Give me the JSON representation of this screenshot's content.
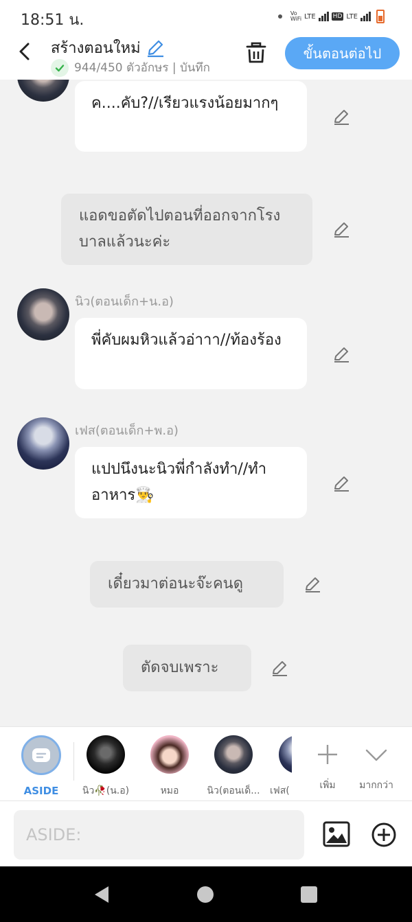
{
  "status_bar": {
    "time": "18:51 น."
  },
  "header": {
    "title": "สร้างตอนใหม่",
    "stats": "944/450 ตัวอักษร | บันทึก",
    "next_label": "ขั้นตอนต่อไป"
  },
  "chat": {
    "messages": [
      {
        "type": "dialogue",
        "text": "ค....คับ?//เรียวแรงน้อยมากๆ"
      },
      {
        "type": "narration",
        "text": "แอดขอตัดไปตอนที่ออกจากโรงบาลแล้วนะค่ะ"
      },
      {
        "type": "dialogue",
        "name": "นิว(ตอนเด็ก+น.อ)",
        "text": "พี่คับผมหิวแล้วอ่าาา//ท้องร้อง"
      },
      {
        "type": "dialogue",
        "name": "เฟส(ตอนเด็ก+พ.อ)",
        "text": "แปปนึงนะนิวพี่กำลังทำ//ทำอาหาร👨‍🍳"
      },
      {
        "type": "narration",
        "text": "เดี๋ยวมาต่อนะจ๊ะคนดู"
      },
      {
        "type": "narration",
        "text": "ตัดจบเพราะ"
      }
    ]
  },
  "characters": {
    "aside_label": "ASIDE",
    "items": [
      {
        "label": "นิว🥀(น.อ)",
        "icon": "avatar-niw-adult"
      },
      {
        "label": "หมอ",
        "icon": "avatar-doctor"
      },
      {
        "label": "นิว(ตอนเด็...",
        "icon": "avatar-niw-child"
      },
      {
        "label": "เฟส(",
        "icon": "avatar-fes-partial"
      }
    ],
    "add_label": "เพิ่ม",
    "more_label": "มากกว่า"
  },
  "input": {
    "placeholder": "ASIDE:"
  },
  "colors": {
    "accent": "#5aa8f5",
    "aside": "#3f8ee3",
    "narration_bg": "#e7e7e7"
  }
}
